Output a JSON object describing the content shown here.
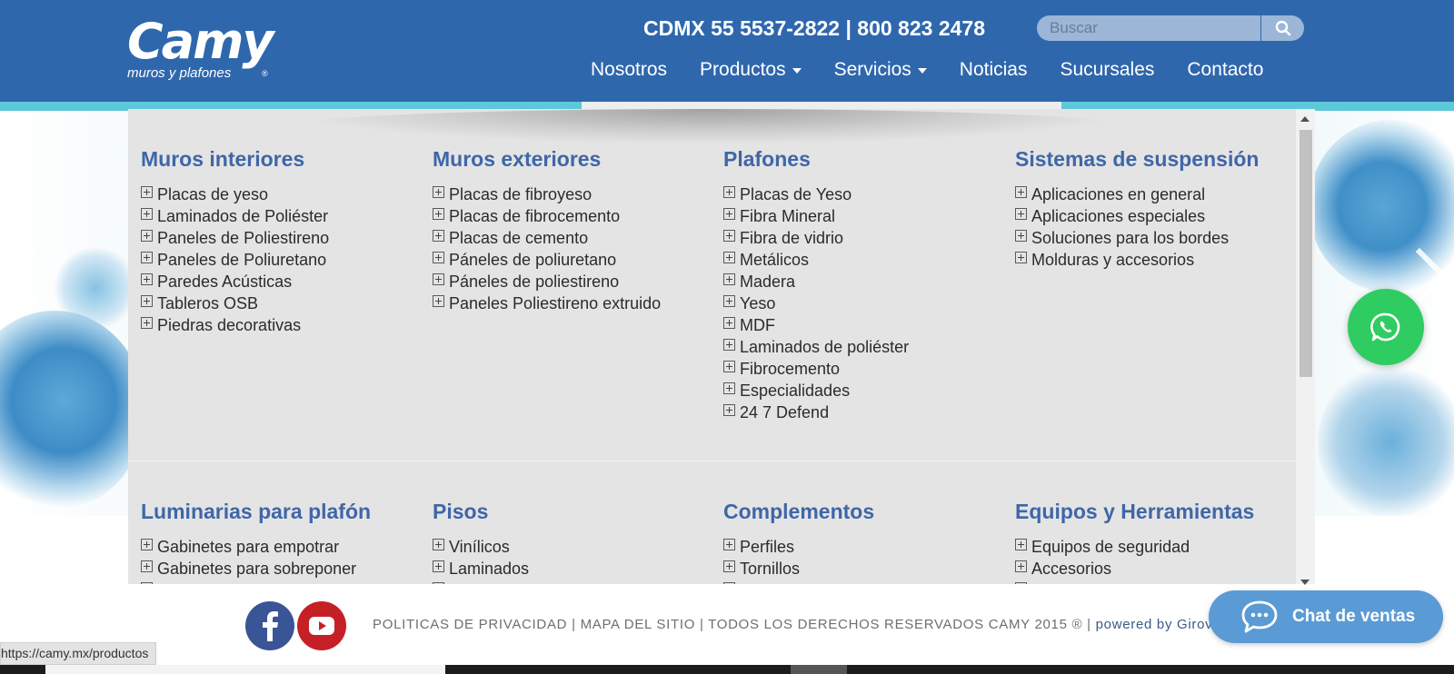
{
  "header": {
    "logo_text": "Camy",
    "logo_tagline": "muros y plafones",
    "logo_registered": "®",
    "phones": "CDMX 55 5537-2822 | 800 823 2478",
    "search_placeholder": "Buscar",
    "search_icon": "search-icon",
    "nav": [
      {
        "label": "Nosotros"
      },
      {
        "label": "Productos"
      },
      {
        "label": "Servicios"
      },
      {
        "label": "Noticias"
      },
      {
        "label": "Sucursales"
      },
      {
        "label": "Contacto"
      }
    ]
  },
  "dropdown": {
    "categories": [
      {
        "title": "Muros interiores",
        "items": [
          "Placas de yeso",
          "Laminados de Poliéster",
          "Paneles de Poliestireno",
          "Paneles de Poliuretano",
          "Paredes Acústicas",
          "Tableros OSB",
          "Piedras decorativas"
        ]
      },
      {
        "title": "Muros exteriores",
        "items": [
          "Placas de fibroyeso",
          "Placas de fibrocemento",
          "Placas de cemento",
          "Páneles de poliuretano",
          "Páneles de poliestireno",
          "Paneles Poliestireno extruido"
        ]
      },
      {
        "title": "Plafones",
        "items": [
          "Placas de Yeso",
          "Fibra Mineral",
          "Fibra de vidrio",
          "Metálicos",
          "Madera",
          "Yeso",
          "MDF",
          "Laminados de poliéster",
          "Fibrocemento",
          "Especialidades",
          "24 7 Defend"
        ]
      },
      {
        "title": "Sistemas de suspensión",
        "items": [
          "Aplicaciones en general",
          "Aplicaciones especiales",
          "Soluciones para los bordes",
          "Molduras y accesorios"
        ]
      },
      {
        "title": "Luminarias para plafón",
        "items": [
          "Gabinetes para empotrar",
          "Gabinetes para sobreponer"
        ]
      },
      {
        "title": "Pisos",
        "items": [
          "Vinílicos",
          "Laminados"
        ]
      },
      {
        "title": "Complementos",
        "items": [
          "Perfiles",
          "Tornillos"
        ]
      },
      {
        "title": "Equipos y Herramientas",
        "items": [
          "Equipos de seguridad",
          "Accesorios"
        ]
      }
    ]
  },
  "footer": {
    "facebook_icon": "facebook-icon",
    "youtube_icon": "youtube-icon",
    "privacy": "POLITICAS DE PRIVACIDAD",
    "sitemap": "MAPA DEL SITIO",
    "rights": "TODOS LOS DERECHOS RESERVADOS CAMY 2015 ®",
    "sep": "|",
    "powered": "powered by Girovisual",
    "chat_label": "Chat de ventas"
  },
  "status_url": "https://camy.mx/productos",
  "colors": {
    "header_blue": "#2f67ad",
    "category_blue": "#3f66a8",
    "whatsapp_green": "#2fcc62",
    "chat_blue": "#5b9bd5",
    "dropdown_bg": "#e4e4e4"
  }
}
